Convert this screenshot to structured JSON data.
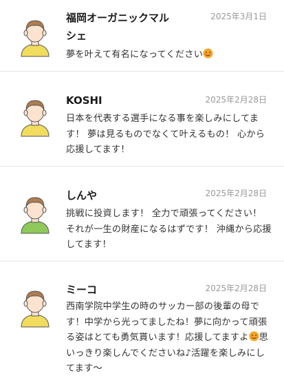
{
  "comments": [
    {
      "name": "福岡オーガニックマル\nシェ",
      "date": "2025年3月1日",
      "text": "夢を叶えて有名になってください",
      "emoji_after": "smiling-face-icon",
      "shirt_color": "#f2dc5d"
    },
    {
      "name": "KOSHI",
      "date": "2025年2月28日",
      "text": "日本を代表する選手になる事を楽しみにしてます！ 夢は見るものでなくて叶えるもの！ 心から応援してます！",
      "shirt_color": "#f2dc5d"
    },
    {
      "name": "しんや",
      "date": "2025年2月28日",
      "text": "挑戦に投資します！ 全力で頑張ってください！ それが一生の財産になるはずです！ 沖縄から応援してます！",
      "shirt_color": "#8fc95a"
    },
    {
      "name": "ミーコ",
      "date": "2025年2月28日",
      "text_part1": "西南学院中学生の時のサッカー部の後輩の母です！中学から光ってましたね！夢に向かって頑張る姿はとても勇気貰います！応援してますよ",
      "text_part2": "思いっきり楽しんでくださいね♪活躍を楽しみにしてます〜",
      "emoji_mid": "smiling-face-icon",
      "shirt_color": "#f2dc5d"
    }
  ]
}
